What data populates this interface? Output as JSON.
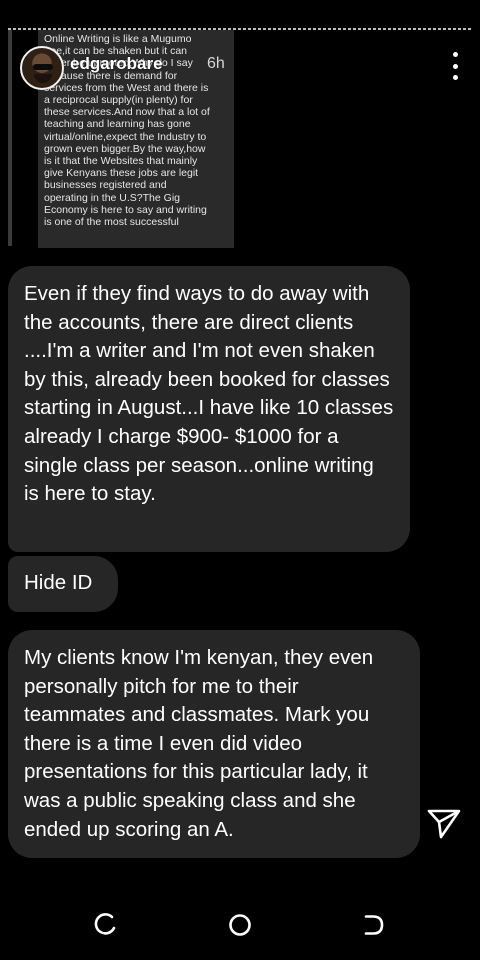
{
  "story": {
    "quoted_text": "Online Writing is like a Mugumo\ntree,it can be shaken but it can\nnever be uprooted.Why do I say\nbecause there is demand for\nservices from the West and there is\na reciprocal supply(in plenty) for\nthese services.And now that a lot of\nteaching and learning has gone\nvirtual/online,expect the Industry to\ngrown even bigger.By the way,how\nis it that the Websites that mainly\ngive Kenyans these jobs are legit\nbusinesses registered and\noperating in the U.S?The Gig\nEconomy is here to say and writing\nis one of the most successful",
    "username": "edgarobare",
    "time": "6h"
  },
  "messages": [
    "Even if they find ways to do away with the accounts, there are direct clients ....I'm a writer and I'm not even shaken by this, already been booked for classes starting in August...I have like 10 classes already I charge $900- $1000 for a single class per season...online writing is here to stay.",
    "Hide ID",
    "My clients know I'm kenyan, they even personally pitch for me to their teammates and classmates. Mark you there is a time I even did video presentations for this particular lady, it was a public speaking class and she ended up scoring an A."
  ],
  "icons": {
    "more": "more-vertical-icon",
    "send": "send-icon",
    "nav": [
      "recent-apps-icon",
      "home-icon",
      "back-icon"
    ]
  }
}
